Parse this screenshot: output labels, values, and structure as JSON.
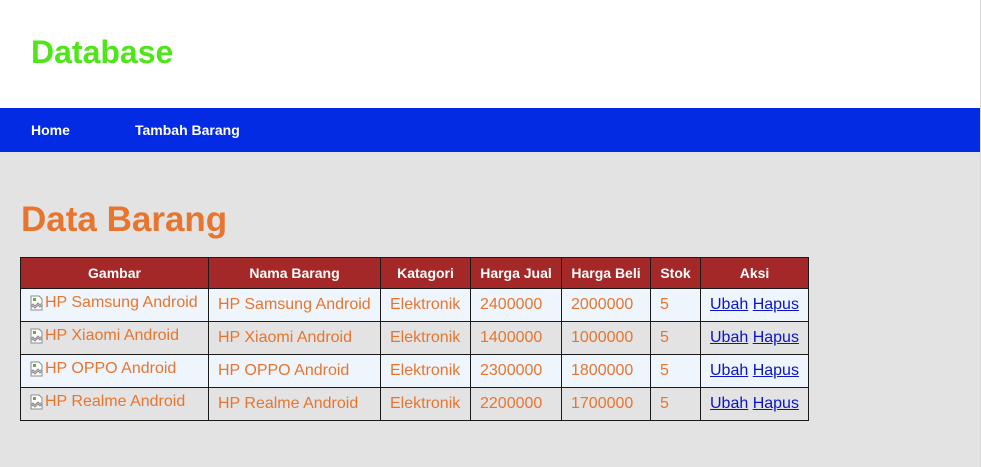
{
  "header": {
    "title": "Database"
  },
  "nav": {
    "items": [
      {
        "label": "Home"
      },
      {
        "label": "Tambah Barang"
      }
    ]
  },
  "main": {
    "title": "Data Barang",
    "table": {
      "columns": [
        "Gambar",
        "Nama Barang",
        "Katagori",
        "Harga Jual",
        "Harga Beli",
        "Stok",
        "Aksi"
      ],
      "rows": [
        {
          "gambar_alt": "HP Samsung Android",
          "nama": "HP Samsung Android",
          "kategori": "Elektronik",
          "harga_jual": "2400000",
          "harga_beli": "2000000",
          "stok": "5",
          "ubah": "Ubah",
          "hapus": "Hapus"
        },
        {
          "gambar_alt": "HP Xiaomi Android",
          "nama": "HP Xiaomi Android",
          "kategori": "Elektronik",
          "harga_jual": "1400000",
          "harga_beli": "1000000",
          "stok": "5",
          "ubah": "Ubah",
          "hapus": "Hapus"
        },
        {
          "gambar_alt": "HP OPPO Android",
          "nama": "HP OPPO Android",
          "kategori": "Elektronik",
          "harga_jual": "2300000",
          "harga_beli": "1800000",
          "stok": "5",
          "ubah": "Ubah",
          "hapus": "Hapus"
        },
        {
          "gambar_alt": "HP Realme Android",
          "nama": "HP Realme Android",
          "kategori": "Elektronik",
          "harga_jual": "2200000",
          "harga_beli": "1700000",
          "stok": "5",
          "ubah": "Ubah",
          "hapus": "Hapus"
        }
      ]
    }
  },
  "colors": {
    "site_title": "#4ee618",
    "navbar": "#022be3",
    "section_title": "#e8752e",
    "table_header": "#a52828",
    "link": "#0a14c9"
  },
  "icons": {
    "broken_image": "broken-image-icon"
  }
}
